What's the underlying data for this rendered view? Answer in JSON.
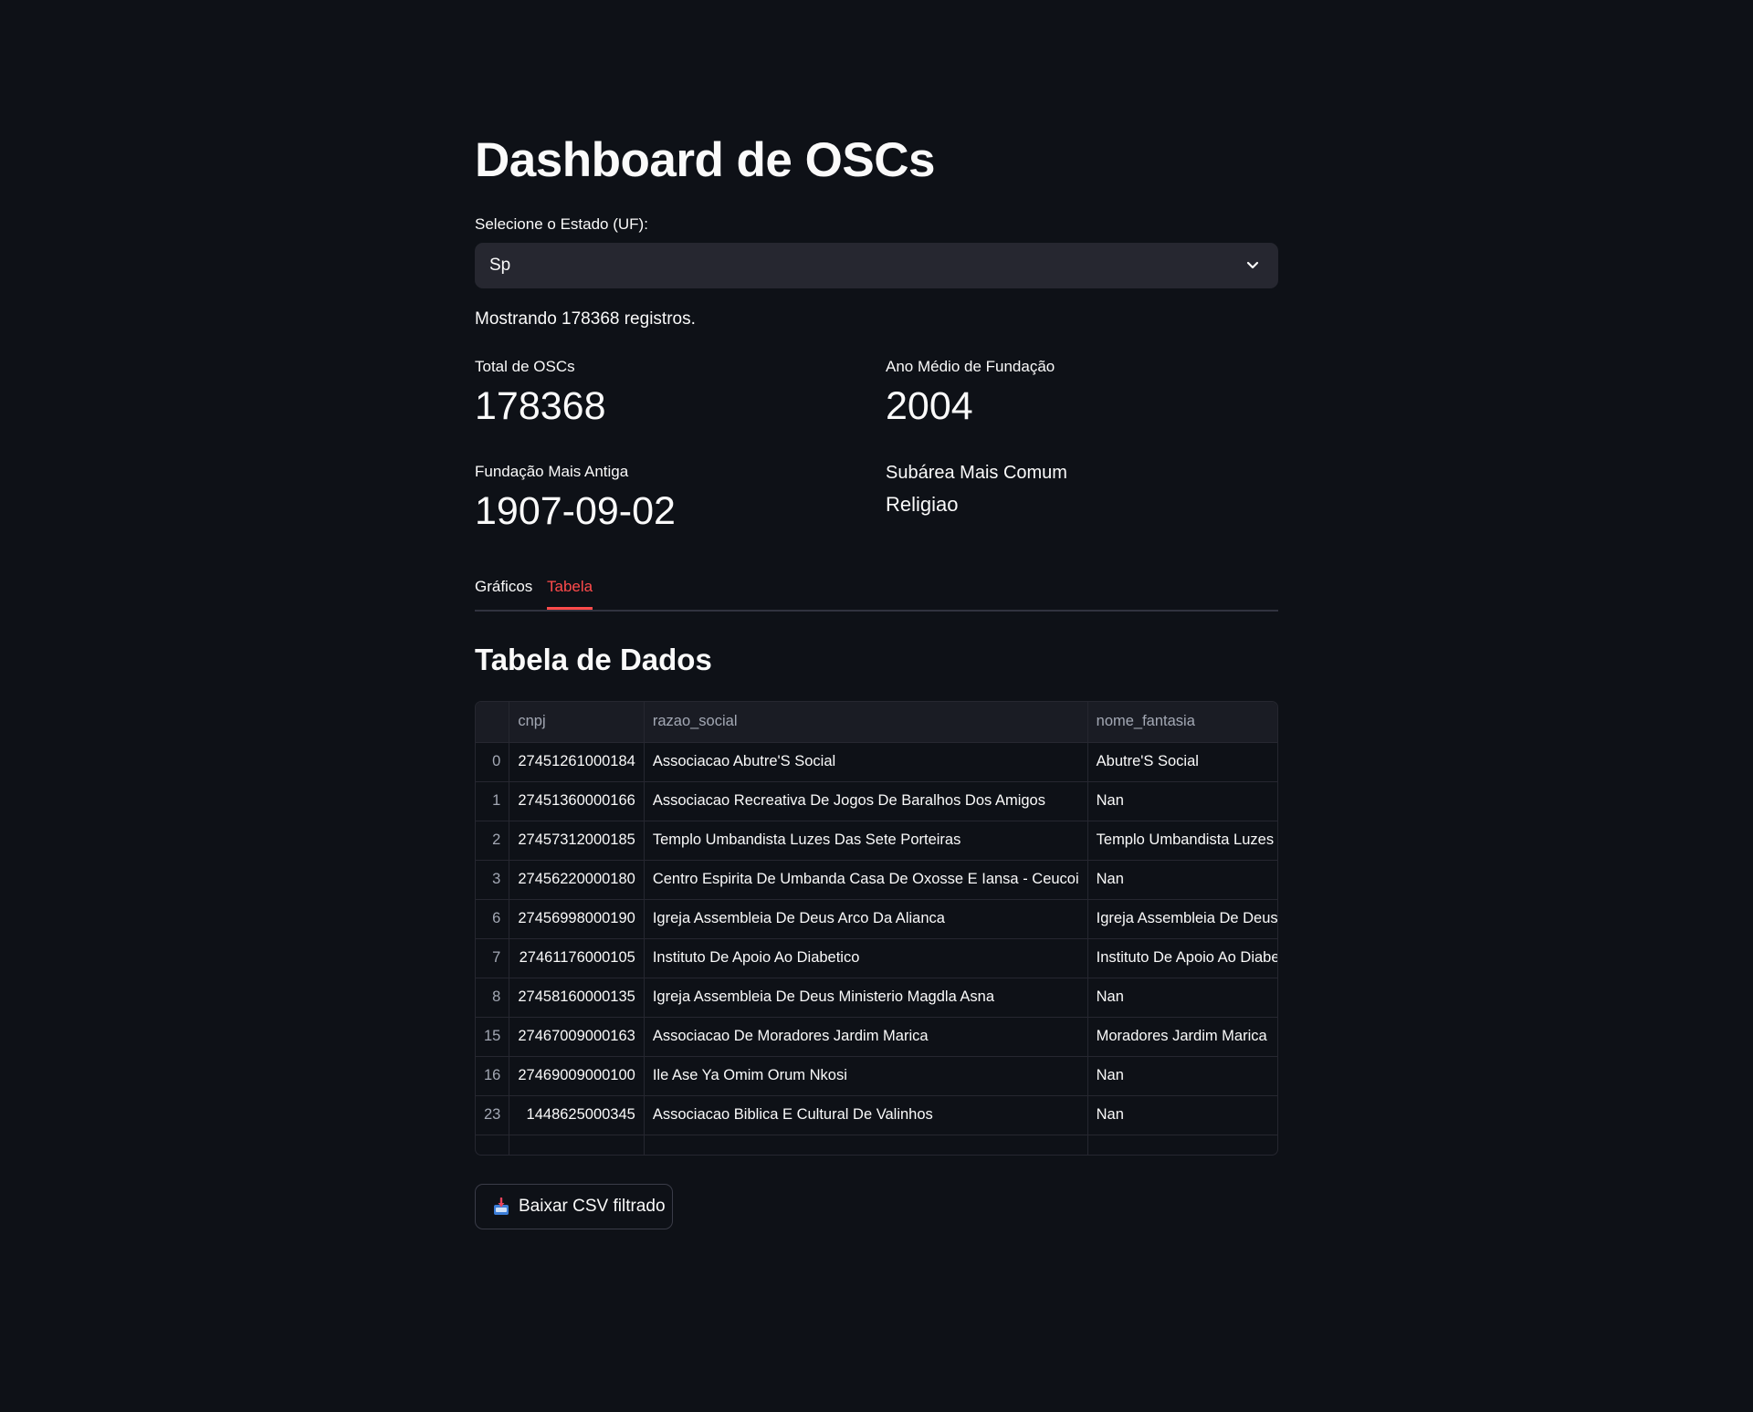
{
  "title": "Dashboard de OSCs",
  "state_select": {
    "label": "Selecione o Estado (UF):",
    "value": "Sp"
  },
  "records_text": "Mostrando 178368 registros.",
  "metrics": {
    "total_label": "Total de OSCs",
    "total_value": "178368",
    "avg_year_label": "Ano Médio de Fundação",
    "avg_year_value": "2004",
    "oldest_label": "Fundação Mais Antiga",
    "oldest_value": "1907-09-02",
    "subarea_label": "Subárea Mais Comum",
    "subarea_value": "Religiao"
  },
  "tabs": [
    {
      "label": "Gráficos",
      "active": false
    },
    {
      "label": "Tabela",
      "active": true
    }
  ],
  "section_title": "Tabela de Dados",
  "table": {
    "columns": [
      "",
      "cnpj",
      "razao_social",
      "nome_fantasia"
    ],
    "rows": [
      {
        "index": "0",
        "cnpj": "27451261000184",
        "razao_social": "Associacao Abutre'S Social",
        "nome_fantasia": "Abutre'S Social"
      },
      {
        "index": "1",
        "cnpj": "27451360000166",
        "razao_social": "Associacao Recreativa De Jogos De Baralhos Dos Amigos",
        "nome_fantasia": "Nan"
      },
      {
        "index": "2",
        "cnpj": "27457312000185",
        "razao_social": "Templo Umbandista Luzes Das Sete Porteiras",
        "nome_fantasia": "Templo Umbandista Luzes"
      },
      {
        "index": "3",
        "cnpj": "27456220000180",
        "razao_social": "Centro Espirita De Umbanda Casa De Oxosse E Iansa - Ceucoi",
        "nome_fantasia": "Nan"
      },
      {
        "index": "6",
        "cnpj": "27456998000190",
        "razao_social": "Igreja Assembleia De Deus Arco Da Alianca",
        "nome_fantasia": "Igreja Assembleia De Deus Arco Da Alianca"
      },
      {
        "index": "7",
        "cnpj": "27461176000105",
        "razao_social": "Instituto De Apoio Ao Diabetico",
        "nome_fantasia": "Instituto De Apoio Ao Diabetico"
      },
      {
        "index": "8",
        "cnpj": "27458160000135",
        "razao_social": "Igreja Assembleia De Deus Ministerio Magdla Asna",
        "nome_fantasia": "Nan"
      },
      {
        "index": "15",
        "cnpj": "27467009000163",
        "razao_social": "Associacao De Moradores Jardim Marica",
        "nome_fantasia": "Moradores Jardim Marica"
      },
      {
        "index": "16",
        "cnpj": "27469009000100",
        "razao_social": "Ile Ase Ya Omim Orum Nkosi",
        "nome_fantasia": "Nan"
      },
      {
        "index": "23",
        "cnpj": "1448625000345",
        "razao_social": "Associacao Biblica E Cultural De Valinhos",
        "nome_fantasia": "Nan"
      },
      {
        "index": "",
        "cnpj": "",
        "razao_social": "",
        "nome_fantasia": ""
      }
    ]
  },
  "download_button": {
    "icon": "inbox-tray-icon",
    "label": "Baixar CSV filtrado"
  },
  "colors": {
    "background": "#0e1117",
    "accent": "#ff4b4b",
    "input_bg": "#262730"
  }
}
